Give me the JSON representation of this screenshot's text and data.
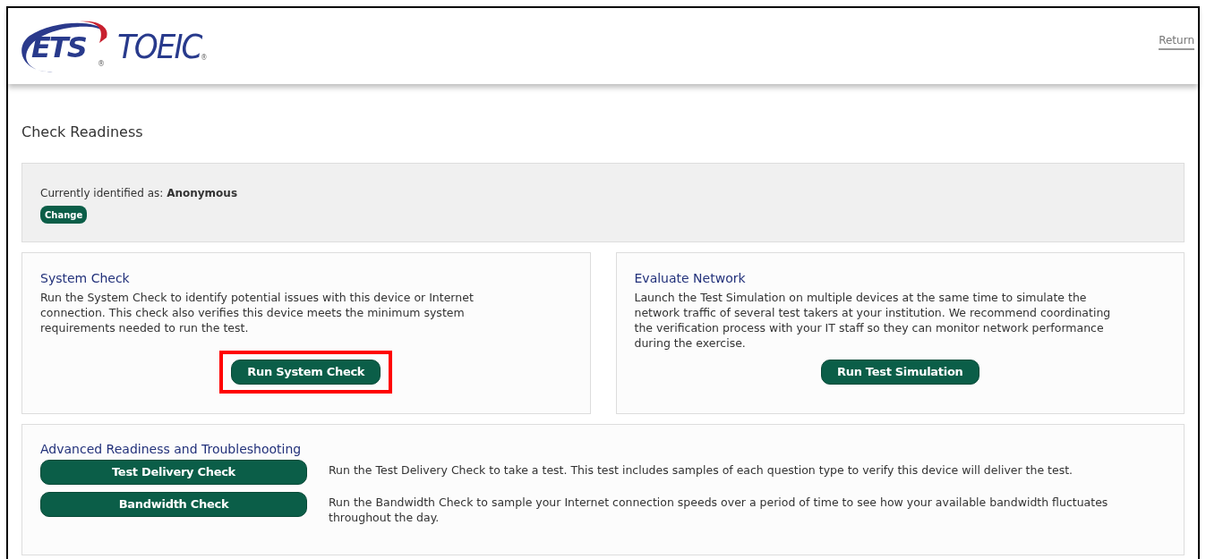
{
  "header": {
    "logo": {
      "left": "ETS",
      "left_mark": "®",
      "right": "TOEIC",
      "right_mark": "®"
    },
    "return_link": "Return"
  },
  "page_title": "Check Readiness",
  "identity": {
    "label": "Currently identified as:",
    "value": "Anonymous",
    "button": "Change"
  },
  "cards": [
    {
      "title": "System Check",
      "text": "Run the System Check to identify potential issues with this device or Internet connection. This check also verifies this device meets the minimum system requirements needed to run the test.",
      "button": "Run System Check",
      "highlighted": true
    },
    {
      "title": "Evaluate Network",
      "text": "Launch the Test Simulation on multiple devices at the same time to simulate the network traffic of several test takers at your institution. We recommend coordinating the verification process with your IT staff so they can monitor network performance during the exercise.",
      "button": "Run Test Simulation",
      "highlighted": false
    }
  ],
  "advanced": {
    "title": "Advanced Readiness and Troubleshooting",
    "items": [
      {
        "button": "Test Delivery Check",
        "text": "Run the Test Delivery Check to take a test. This test includes samples of each question type to verify this device will deliver the test."
      },
      {
        "button": "Bandwidth Check",
        "text": "Run the Bandwidth Check to sample your Internet connection speeds over a period of time to see how your available bandwidth fluctuates throughout the day."
      }
    ]
  }
}
